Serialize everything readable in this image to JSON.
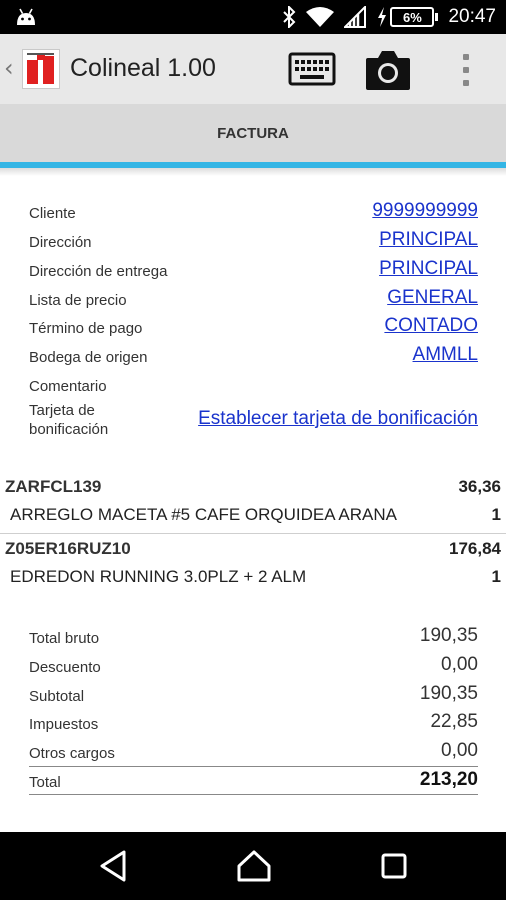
{
  "status_bar": {
    "battery_percent": "6%",
    "time": "20:47"
  },
  "action_bar": {
    "title": "Colineal 1.00",
    "icons": [
      "android-icon",
      "bluetooth-icon",
      "wifi-icon",
      "signal-icon",
      "battery-charging-icon",
      "keyboard-icon",
      "camera-icon",
      "overflow-menu-icon"
    ]
  },
  "tab": {
    "label": "FACTURA",
    "indicator_color": "#33b5e5"
  },
  "header_fields": [
    {
      "label": "Cliente",
      "value": "9999999999"
    },
    {
      "label": "Dirección",
      "value": "PRINCIPAL"
    },
    {
      "label": "Dirección de entrega",
      "value": "PRINCIPAL"
    },
    {
      "label": "Lista de precio",
      "value": "GENERAL"
    },
    {
      "label": "Término de pago",
      "value": "CONTADO"
    },
    {
      "label": "Bodega de origen",
      "value": "AMMLL"
    },
    {
      "label": "Comentario",
      "value": ""
    }
  ],
  "bonus_card": {
    "label_line1": "Tarjeta de",
    "label_line2": "bonificación",
    "link": "Establecer tarjeta de bonificación"
  },
  "items": [
    {
      "code": "ZARFCL139",
      "amount": "36,36",
      "description": "ARREGLO MACETA #5 CAFE ORQUIDEA ARANA",
      "quantity": "1"
    },
    {
      "code": "Z05ER16RUZ10",
      "amount": "176,84",
      "description": "EDREDON RUNNING 3.0PLZ + 2 ALM",
      "quantity": "1"
    }
  ],
  "totals": [
    {
      "label": "Total bruto",
      "value": "190,35"
    },
    {
      "label": "Descuento",
      "value": "0,00"
    },
    {
      "label": "Subtotal",
      "value": "190,35"
    },
    {
      "label": "Impuestos",
      "value": "22,85"
    },
    {
      "label": "Otros cargos",
      "value": "0,00"
    },
    {
      "label": "Total",
      "value": "213,20"
    }
  ],
  "colors": {
    "link": "#1a33cc",
    "action_bar_bg": "#e8e8e8",
    "tab_bg": "#d9d9d9",
    "logo_red": "#e02020"
  }
}
